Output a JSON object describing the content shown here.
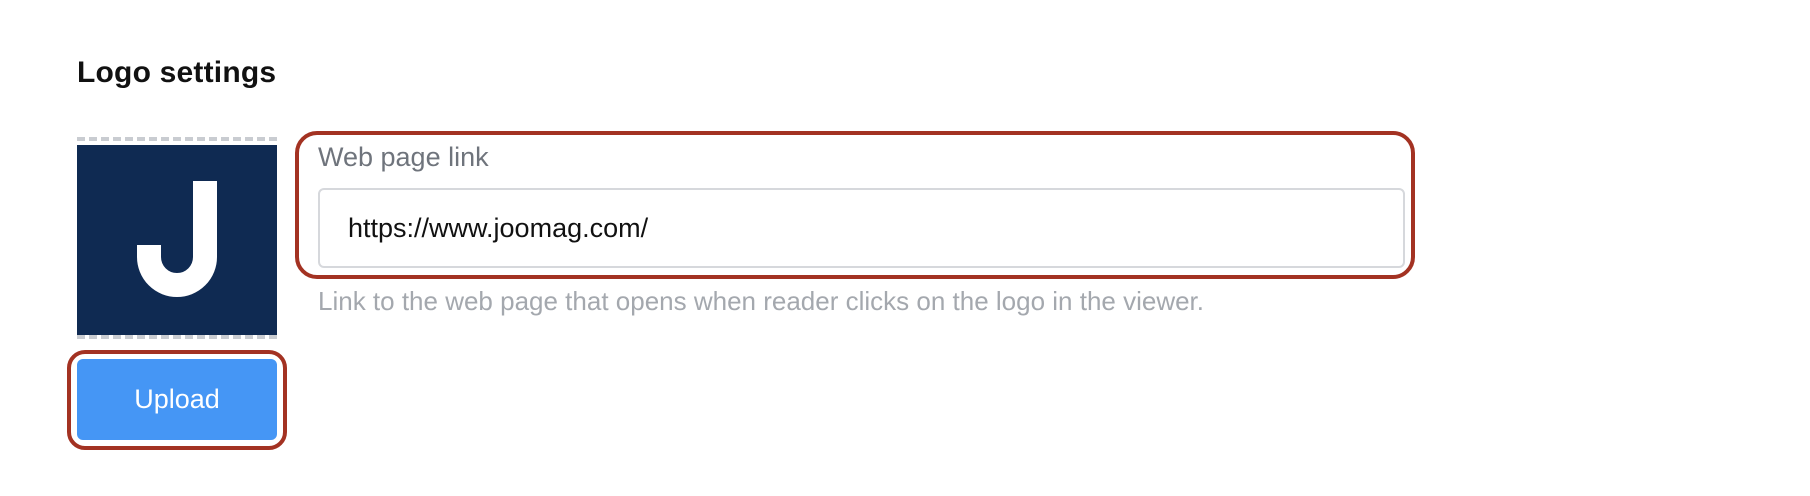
{
  "logo_settings": {
    "title": "Logo settings",
    "logo": {
      "icon": "letter-j-logo-icon",
      "letter": "J",
      "background_color": "#0f2a52",
      "glyph_color": "#ffffff"
    },
    "upload_label": "Upload",
    "web_link": {
      "label": "Web page link",
      "value": "https://www.joomag.com/",
      "placeholder": "",
      "help": "Link to the web page that opens when reader clicks on the logo in the viewer."
    }
  },
  "colors": {
    "accent": "#4596f5",
    "highlight_ring": "#a33222"
  }
}
